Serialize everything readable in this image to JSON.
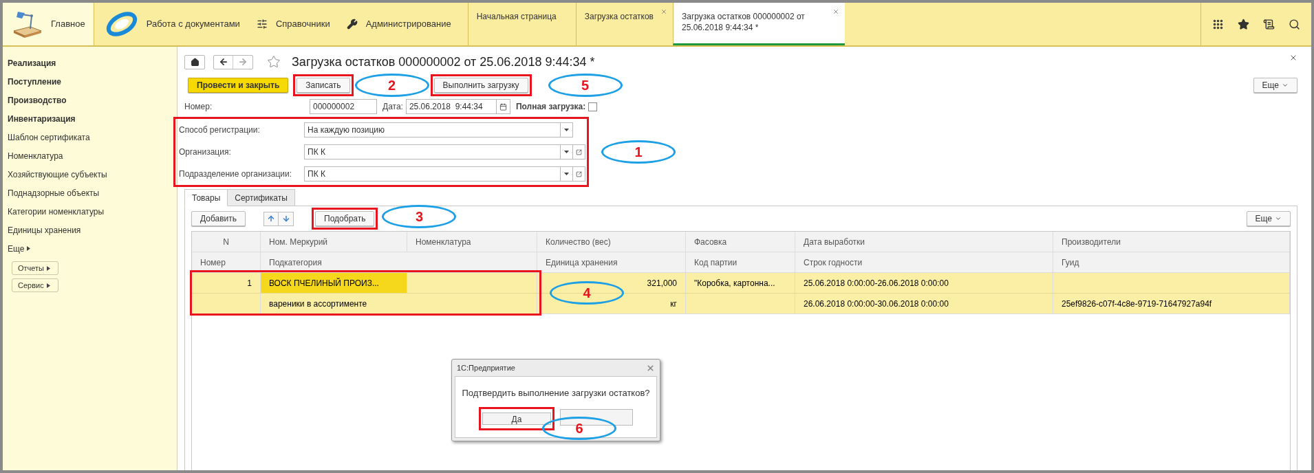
{
  "top_nav": {
    "sections": [
      {
        "label": "Главное",
        "kind": "home",
        "selected": true
      },
      {
        "label": "Работа с документами",
        "kind": "documents",
        "selected": false
      },
      {
        "label": "Справочники",
        "kind": "catalogs",
        "selected": false
      },
      {
        "label": "Администрирование",
        "kind": "admin",
        "selected": false
      }
    ],
    "open_tabs": [
      {
        "label": "Начальная страница",
        "selected": false,
        "closable": false
      },
      {
        "label": "Загрузка остатков",
        "selected": false,
        "closable": true
      },
      {
        "label": "Загрузка остатков 000000002 от 25.06.2018 9:44:34 *",
        "selected": true,
        "closable": true
      }
    ]
  },
  "sidebar": {
    "items": [
      {
        "label": "Реализация",
        "bold": true
      },
      {
        "label": "Поступление",
        "bold": true
      },
      {
        "label": "Производство",
        "bold": true
      },
      {
        "label": "Инвентаризация",
        "bold": true
      },
      {
        "label": "Шаблон сертификата",
        "bold": false
      },
      {
        "label": "Номенклатура",
        "bold": false
      },
      {
        "label": "Хозяйствующие субъекты",
        "bold": false
      },
      {
        "label": "Поднадзорные объекты",
        "bold": false
      },
      {
        "label": "Категории номенклатуры",
        "bold": false
      },
      {
        "label": "Единицы хранения",
        "bold": false
      }
    ],
    "more": "Еще",
    "buttons": [
      "Отчеты",
      "Сервис"
    ]
  },
  "form": {
    "title": "Загрузка остатков 000000002 от 25.06.2018 9:44:34 *",
    "commands": [
      {
        "label": "Провести и закрыть",
        "kind": "primary",
        "highlighted": false
      },
      {
        "label": "Записать",
        "kind": "normal",
        "highlighted": true,
        "callout": "2"
      },
      {
        "label": "Выполнить загрузку",
        "kind": "normal",
        "highlighted": true,
        "callout": "5"
      }
    ],
    "more": "Еще",
    "number": {
      "label": "Номер:",
      "value": "000000002"
    },
    "date": {
      "label": "Дата:",
      "value": "25.06.2018  9:44:34"
    },
    "full_load": {
      "label": "Полная загрузка:",
      "checked": false
    },
    "settings": {
      "highlighted": true,
      "callout": "1",
      "fields": [
        {
          "label": "Способ регистрации:",
          "value": "На каждую позицию",
          "kind": "select"
        },
        {
          "label": "Организация:",
          "value": "ПК К",
          "kind": "reference"
        },
        {
          "label": "Подразделение организации:",
          "value": "ПК К",
          "kind": "reference"
        }
      ]
    },
    "tabs": [
      {
        "label": "Товары",
        "selected": true
      },
      {
        "label": "Сертификаты",
        "selected": false
      }
    ],
    "table_toolbar": {
      "add": "Добавить",
      "pick": {
        "label": "Подобрать",
        "highlighted": true,
        "callout": "3"
      },
      "more": "Еще"
    },
    "table": {
      "header_top": [
        "N",
        "Ном. Меркурий",
        "Номенклатура",
        "Количество (вес)",
        "Фасовка",
        "Дата выработки",
        "Производители"
      ],
      "header_bottom": [
        "Номер",
        "Подкатегория",
        "Единица хранения",
        "Код партии",
        "Строк годности",
        "Гуид"
      ],
      "rows": [
        {
          "selected": true,
          "highlighted": true,
          "callout": "4",
          "line_1": [
            {
              "text": "1",
              "selected": false
            },
            {
              "text": "ВОСК ПЧЕЛИНЫЙ ПРОИЗ...",
              "selected": true
            },
            {
              "selected": false
            },
            {
              "text": "321,000",
              "selected": false
            },
            {
              "text": "\"Коробка, картонна...",
              "selected": false
            },
            {
              "text": "25.06.2018 0:00:00-26.06.2018 0:00:00",
              "selected": false
            },
            {
              "selected": false
            }
          ],
          "line_2": {
            "subcategory": "вареники в ассортименте",
            "unit": "кг",
            "shelf_life": "26.06.2018 0:00:00-30.06.2018 0:00:00",
            "guid": "25ef9826-c07f-4c8e-9719-71647927a94f"
          }
        }
      ]
    },
    "dialog": {
      "title": "1С:Предприятие",
      "message": "Подтвердить выполнение загрузки остатков?",
      "confirm": {
        "label": "Да",
        "highlighted": true
      },
      "callout": "6"
    }
  }
}
